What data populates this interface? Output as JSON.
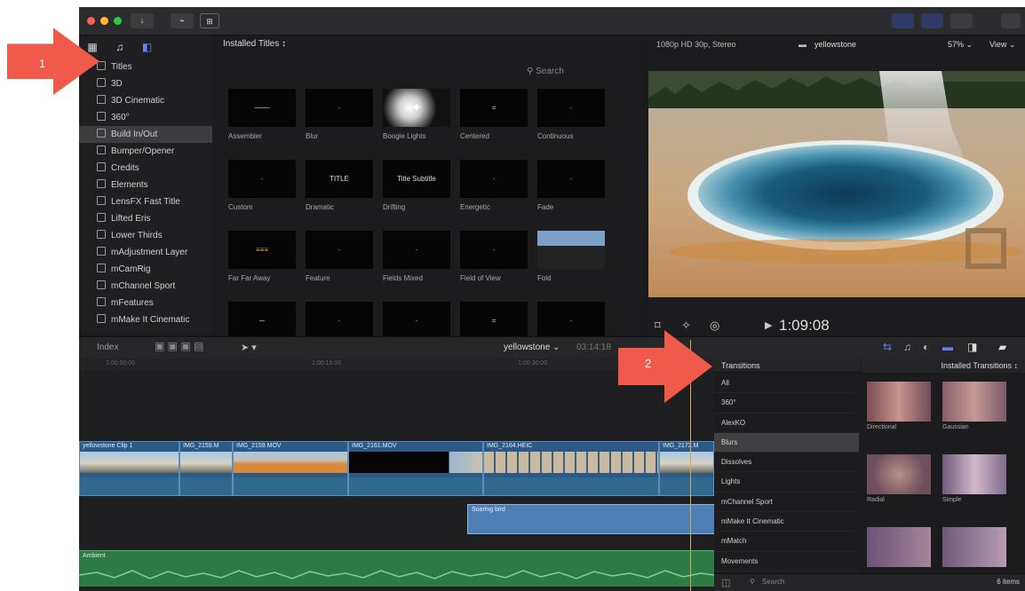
{
  "colors": {
    "accent": "#3c5bd6",
    "arrow": "#ef5a4a",
    "clip_blue": "#2c5a86",
    "audio_green": "#2d7a44",
    "playhead": "#d8a84a"
  },
  "toolbar": {
    "small_btn_label": "↓",
    "media_btn_label": "⊞"
  },
  "sidebar": {
    "icons": [
      "photos-icon",
      "music-icon",
      "titles-icon"
    ],
    "items": [
      {
        "label": "Titles",
        "selected": false
      },
      {
        "label": "3D",
        "selected": false
      },
      {
        "label": "3D Cinematic",
        "selected": false
      },
      {
        "label": "360°",
        "selected": false
      },
      {
        "label": "Build In/Out",
        "selected": true
      },
      {
        "label": "Bumper/Opener",
        "selected": false
      },
      {
        "label": "Credits",
        "selected": false
      },
      {
        "label": "Elements",
        "selected": false
      },
      {
        "label": "LensFX Fast Title",
        "selected": false
      },
      {
        "label": "Lifted Eris",
        "selected": false
      },
      {
        "label": "Lower Thirds",
        "selected": false
      },
      {
        "label": "mAdjustment Layer",
        "selected": false
      },
      {
        "label": "mCamRig",
        "selected": false
      },
      {
        "label": "mChannel Sport",
        "selected": false
      },
      {
        "label": "mFeatures",
        "selected": false
      },
      {
        "label": "mMake It Cinematic",
        "selected": false
      }
    ]
  },
  "browser": {
    "header": "Installed Titles ↕",
    "search_placeholder": "Search",
    "cells": [
      {
        "label": "Assembler",
        "thumb_text": "───"
      },
      {
        "label": "Blur",
        "thumb_text": "·"
      },
      {
        "label": "Boogie Lights",
        "thumb_text": "✦"
      },
      {
        "label": "Centered",
        "thumb_text": "="
      },
      {
        "label": "Continuous",
        "thumb_text": "·"
      },
      {
        "label": "Custom",
        "thumb_text": "·"
      },
      {
        "label": "Dramatic",
        "thumb_text": "TITLE"
      },
      {
        "label": "Drifting",
        "thumb_text": "Title Subtitle"
      },
      {
        "label": "Energetic",
        "thumb_text": "·"
      },
      {
        "label": "Fade",
        "thumb_text": "·"
      },
      {
        "label": "Far Far Away",
        "thumb_text": "≡≡≡"
      },
      {
        "label": "Feature",
        "thumb_text": "·"
      },
      {
        "label": "Fields Mixed",
        "thumb_text": "·"
      },
      {
        "label": "Field of View",
        "thumb_text": "·"
      },
      {
        "label": "Fold",
        "thumb_text": ""
      },
      {
        "label": "",
        "thumb_text": "─"
      },
      {
        "label": "",
        "thumb_text": "·"
      },
      {
        "label": "",
        "thumb_text": "·"
      },
      {
        "label": "",
        "thumb_text": "="
      },
      {
        "label": "",
        "thumb_text": "·"
      }
    ]
  },
  "viewer": {
    "format": "1080p HD 30p, Stereo",
    "project": "yellowstone",
    "zoom": "57% ⌄",
    "view": "View ⌄",
    "timecode": "1:09:08"
  },
  "timeline": {
    "index_label": "Index",
    "project": "yellowstone ⌄",
    "duration": "03:14:18",
    "ruler": [
      "1:00:00:00",
      "1:00:15:00",
      "1:00:30:00"
    ],
    "clips": [
      {
        "title": "yellowstone Clip 1",
        "variant": "sky"
      },
      {
        "title": "IMG_2159.M",
        "variant": "sky"
      },
      {
        "title": "IMG_2159.MOV",
        "variant": "orange"
      },
      {
        "title": "IMG_2161.MOV",
        "variant": "dark"
      },
      {
        "title": "IMG_2164.HEIC",
        "variant": "frames"
      },
      {
        "title": "IMG_2172.M",
        "variant": "sky"
      }
    ],
    "audio_blue_title": "Soaring bird",
    "audio_green_title": "Ambient"
  },
  "transitions": {
    "title": "Transitions",
    "header_right": "Installed Transitions ↕",
    "items": [
      {
        "label": "All",
        "selected": false
      },
      {
        "label": "360°",
        "selected": false
      },
      {
        "label": "AlexKO",
        "selected": false
      },
      {
        "label": "Blurs",
        "selected": true
      },
      {
        "label": "Dissolves",
        "selected": false
      },
      {
        "label": "Lights",
        "selected": false
      },
      {
        "label": "mChannel Sport",
        "selected": false
      },
      {
        "label": "mMake It Cinematic",
        "selected": false
      },
      {
        "label": "mMatch",
        "selected": false
      },
      {
        "label": "Movements",
        "selected": false
      }
    ],
    "thumbs": [
      {
        "label": "Directional"
      },
      {
        "label": "Gaussian"
      },
      {
        "label": "Radial"
      },
      {
        "label": "Simple"
      },
      {
        "label": ""
      },
      {
        "label": ""
      }
    ],
    "search_placeholder": "Search",
    "count": "6 items"
  },
  "callouts": {
    "one": "1",
    "two": "2"
  }
}
